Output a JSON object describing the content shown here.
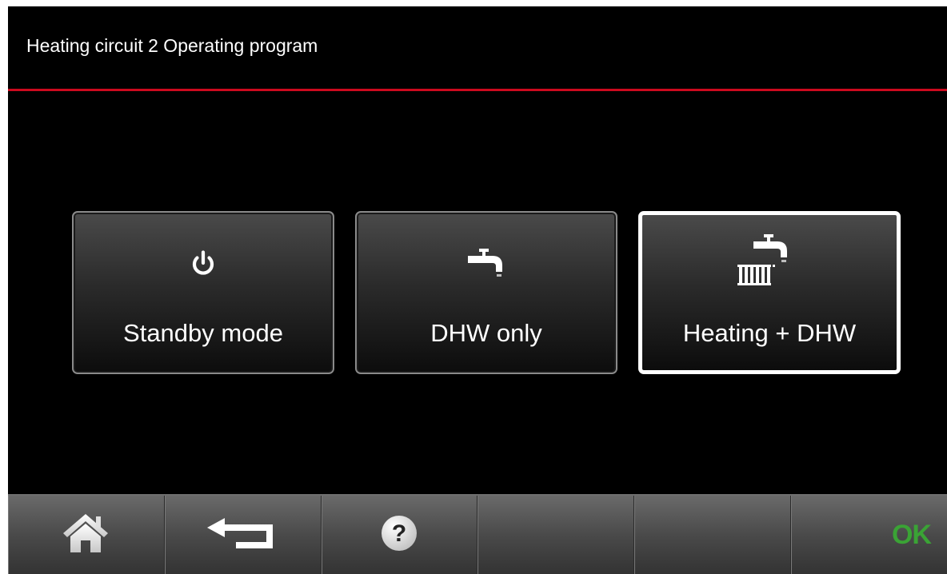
{
  "header": {
    "title": "Heating circuit 2 Operating program",
    "accent_color": "#cc0a1e"
  },
  "modes": [
    {
      "label": "Standby mode",
      "icon": "power-icon",
      "selected": false
    },
    {
      "label": "DHW only",
      "icon": "tap-icon",
      "selected": false
    },
    {
      "label": "Heating + DHW",
      "icon": "radiator-tap-icon",
      "selected": true
    }
  ],
  "footer": {
    "buttons": [
      {
        "name": "home",
        "icon": "home-icon"
      },
      {
        "name": "back",
        "icon": "back-arrow-icon"
      },
      {
        "name": "help",
        "icon": "help-icon"
      },
      {
        "name": "empty-1",
        "icon": ""
      },
      {
        "name": "empty-2",
        "icon": ""
      },
      {
        "name": "ok",
        "icon": ""
      }
    ],
    "ok_label": "OK",
    "ok_color": "#3aa335"
  }
}
